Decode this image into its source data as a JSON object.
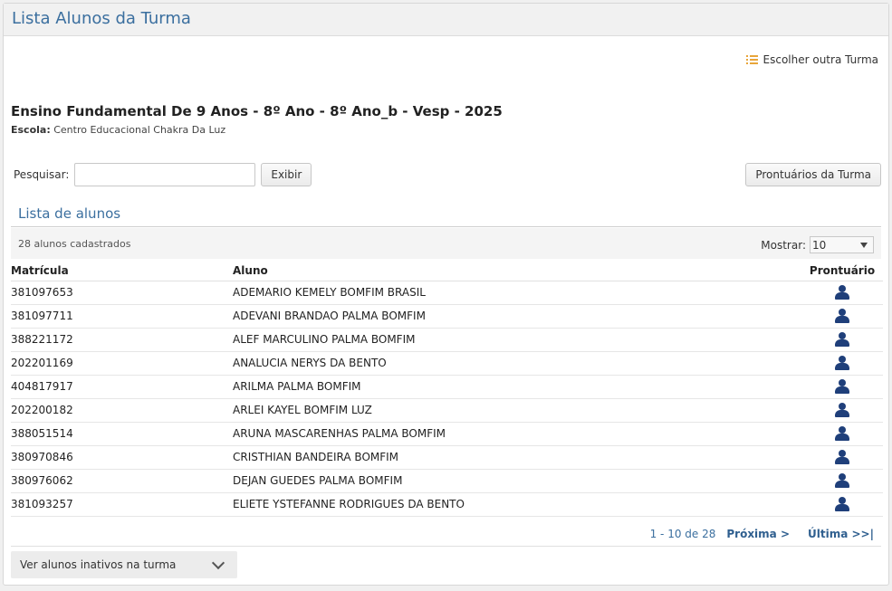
{
  "header": {
    "title": "Lista Alunos da Turma"
  },
  "choose_link": {
    "label": "Escolher outra Turma",
    "icon": "list-icon"
  },
  "turma": {
    "name": "Ensino Fundamental De 9 Anos - 8º Ano - 8º Ano_b - Vesp - 2025",
    "escola_label": "Escola:",
    "escola_value": "Centro Educacional Chakra Da Luz"
  },
  "search": {
    "label": "Pesquisar:",
    "value": "",
    "placeholder": "",
    "button": "Exibir"
  },
  "prontuarios_button": "Prontuários da Turma",
  "section": {
    "title": "Lista de alunos"
  },
  "toolbar": {
    "count": "28 alunos cadastrados",
    "show_label": "Mostrar:",
    "show_value": "10"
  },
  "table": {
    "headers": {
      "matricula": "Matrícula",
      "aluno": "Aluno",
      "prontuario": "Prontuário"
    },
    "rows": [
      {
        "matricula": "381097653",
        "aluno": "ADEMARIO KEMELY BOMFIM BRASIL"
      },
      {
        "matricula": "381097711",
        "aluno": "ADEVANI BRANDAO PALMA BOMFIM"
      },
      {
        "matricula": "388221172",
        "aluno": "ALEF MARCULINO PALMA BOMFIM"
      },
      {
        "matricula": "202201169",
        "aluno": "ANALUCIA NERYS DA BENTO"
      },
      {
        "matricula": "404817917",
        "aluno": "ARILMA PALMA BOMFIM"
      },
      {
        "matricula": "202200182",
        "aluno": "ARLEI KAYEL BOMFIM LUZ"
      },
      {
        "matricula": "388051514",
        "aluno": "ARUNA MASCARENHAS PALMA BOMFIM"
      },
      {
        "matricula": "380970846",
        "aluno": "CRISTHIAN BANDEIRA BOMFIM"
      },
      {
        "matricula": "380976062",
        "aluno": "DEJAN GUEDES PALMA BOMFIM"
      },
      {
        "matricula": "381093257",
        "aluno": "ELIETE YSTEFANNE RODRIGUES DA BENTO"
      }
    ]
  },
  "pager": {
    "range": "1 - 10 de 28",
    "next": "Próxima >",
    "last": "Última >>|"
  },
  "inativos": {
    "label": "Ver alunos inativos na turma"
  },
  "colors": {
    "accent": "#3b6f9f",
    "icon": "#1f3f7a",
    "list_icon": "#e8a53a"
  }
}
